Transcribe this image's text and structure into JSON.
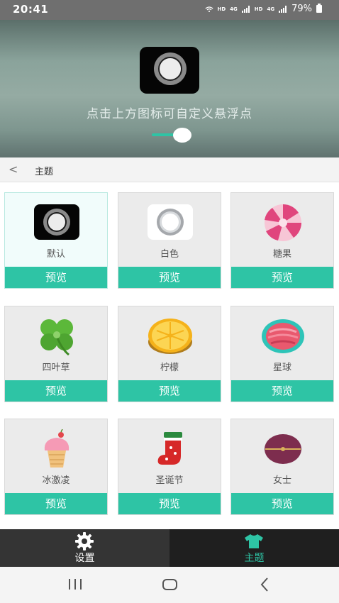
{
  "status": {
    "time": "20:41",
    "network1": "HD",
    "network2": "HD",
    "signal_label": "4G",
    "battery": "79%"
  },
  "hero": {
    "hint": "点击上方图标可自定义悬浮点"
  },
  "header": {
    "title": "主题"
  },
  "themes": [
    {
      "name": "默认",
      "button": "预览"
    },
    {
      "name": "白色",
      "button": "预览"
    },
    {
      "name": "糖果",
      "button": "预览"
    },
    {
      "name": "四叶草",
      "button": "预览"
    },
    {
      "name": "柠檬",
      "button": "预览"
    },
    {
      "name": "星球",
      "button": "预览"
    },
    {
      "name": "冰激凌",
      "button": "预览"
    },
    {
      "name": "圣诞节",
      "button": "预览"
    },
    {
      "name": "女士",
      "button": "预览"
    }
  ],
  "tabs": [
    {
      "label": "设置"
    },
    {
      "label": "主题"
    }
  ],
  "colors": {
    "accent": "#2ec4a5",
    "tab_bar": "#2b2b2b"
  }
}
